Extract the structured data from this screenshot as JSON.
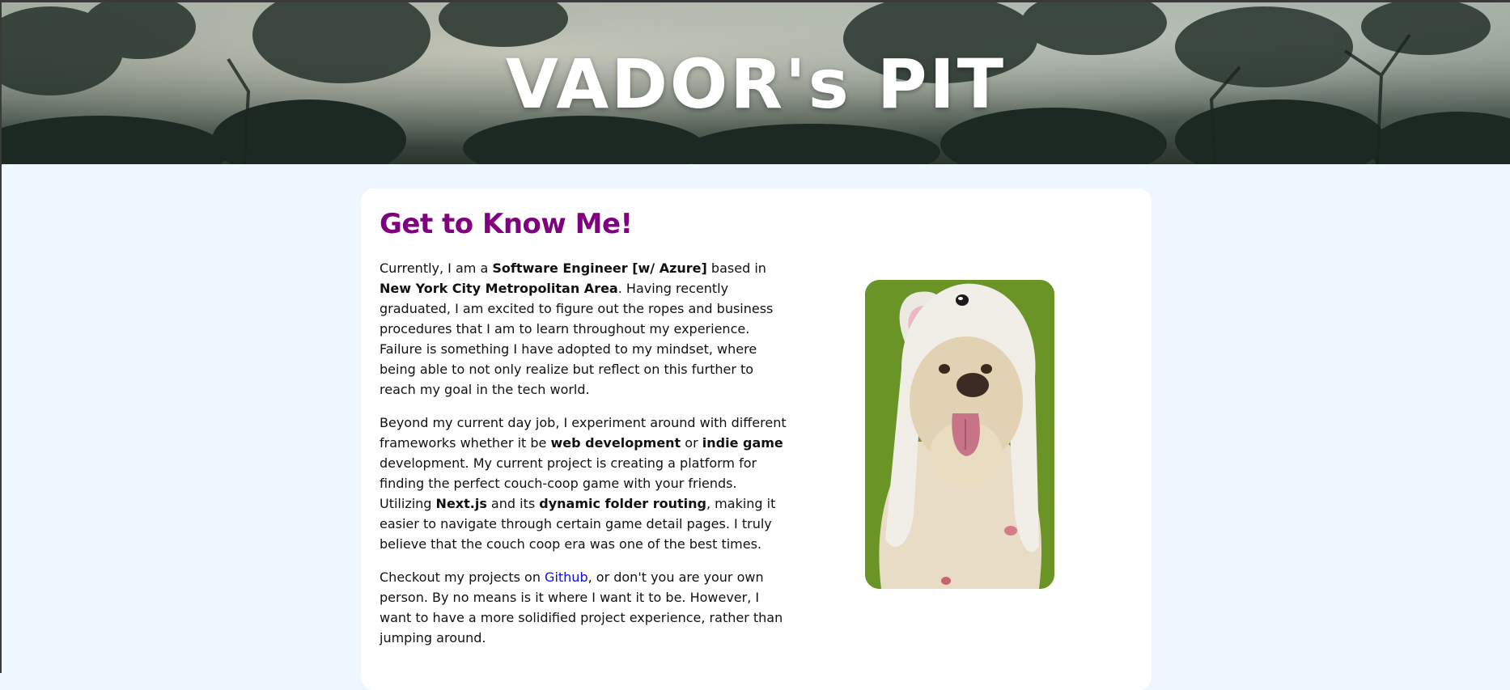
{
  "banner": {
    "title": "VADOR's PIT"
  },
  "about": {
    "heading": "Get to Know Me!",
    "p1": {
      "t1": "Currently, I am a ",
      "b1": "Software Engineer [w/ Azure]",
      "t2": " based in ",
      "b2": "New York City Metropolitan Area",
      "t3": ". Having recently graduated, I am excited to figure out the ropes and business procedures that I am to learn throughout my experience. Failure is something I have adopted to my mindset, where being able to not only realize but reflect on this further to reach my goal in the tech world."
    },
    "p2": {
      "t1": "Beyond my current day job, I experiment around with different frameworks whether it be ",
      "b1": "web development",
      "t2": " or ",
      "b2": "indie game",
      "t3": " development. My current project is creating a platform for finding the perfect couch-coop game with your friends. Utilizing ",
      "b3": "Next.js",
      "t4": " and its ",
      "b4": "dynamic folder routing",
      "t5": ", making it easier to navigate through certain game detail pages. I truly believe that the couch coop era was one of the best times."
    },
    "p3": {
      "t1": "Checkout my projects on ",
      "link": "Github",
      "t2": ", or don't you are your own person. By no means is it where I want it to be. However, I want to have a more solidified project experience, rather than jumping around."
    }
  },
  "colors": {
    "heading": "#800080",
    "link": "#1010e0",
    "page_background": "#eef6ff",
    "photo_background": "#6a9426"
  },
  "images": {
    "banner": "misty-jungle-canopy",
    "photo": "dog-in-bunny-hat"
  }
}
